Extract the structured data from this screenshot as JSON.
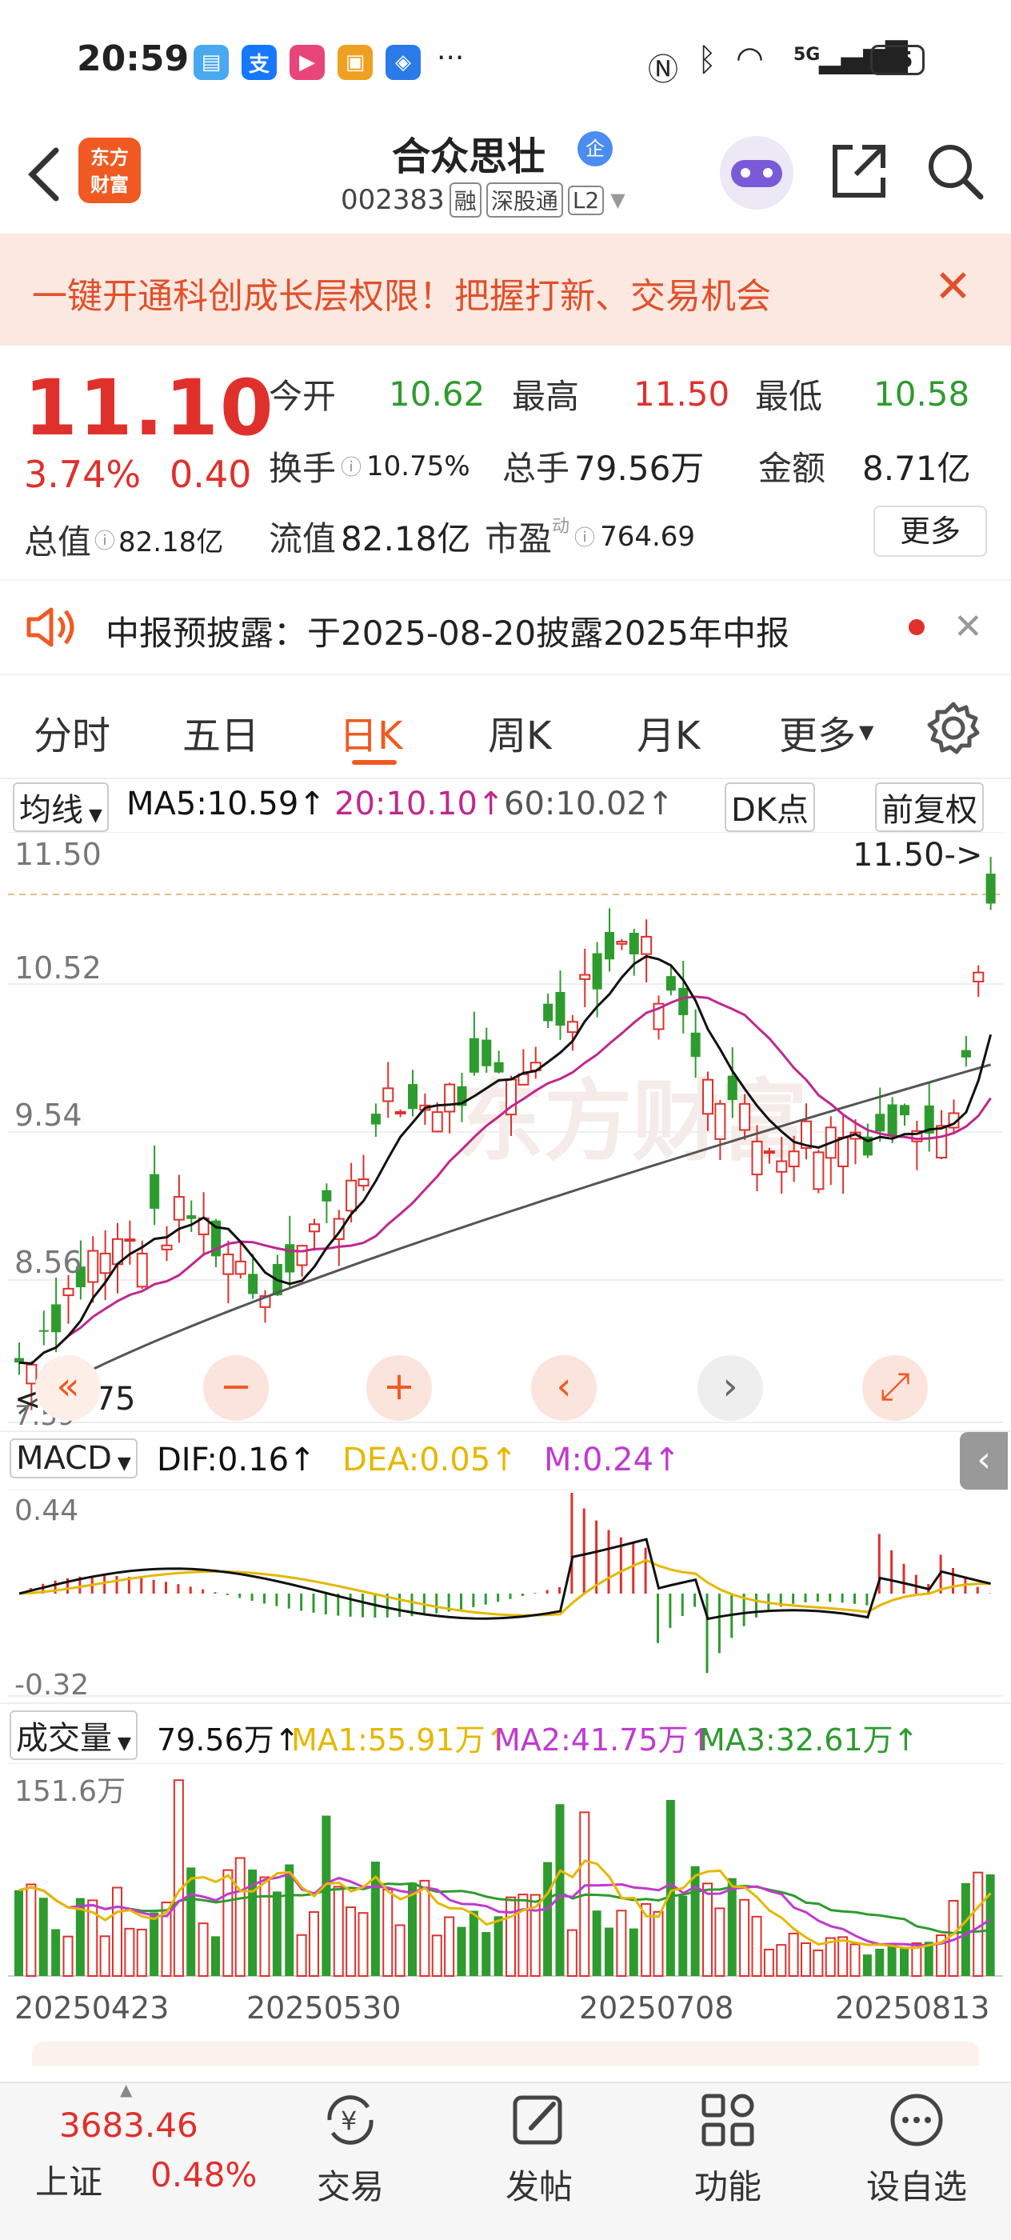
{
  "status_bar": {
    "time": "20:59",
    "battery": "55",
    "signal": "5G",
    "more": "···"
  },
  "header": {
    "stock_name": "合众思壮",
    "badge": "企",
    "stock_code": "002383",
    "tags": [
      "融",
      "深股通",
      "L2"
    ],
    "logo_line1": "东方",
    "logo_line2": "财富"
  },
  "banner": {
    "text": "一键开通科创成长层权限！把握打新、交易机会"
  },
  "quote": {
    "price": "11.10",
    "change_pct": "3.74%",
    "change_abs": "0.40",
    "open_label": "今开",
    "open": "10.62",
    "high_label": "最高",
    "high": "11.50",
    "low_label": "最低",
    "low": "10.58",
    "turnover_label": "换手",
    "turnover": "10.75%",
    "volume_label": "总手",
    "volume": "79.56万",
    "amount_label": "金额",
    "amount": "8.71亿",
    "mktcap_label": "总值",
    "mktcap": "82.18亿",
    "float_label": "流值",
    "float_cap": "82.18亿",
    "pe_label": "市盈",
    "pe_sup": "动",
    "pe": "764.69",
    "more_button": "更多"
  },
  "notice": {
    "text": "中报预披露：于2025-08-20披露2025年中报"
  },
  "tabs": [
    "分时",
    "五日",
    "日K",
    "周K",
    "月K",
    "更多"
  ],
  "ma_row": {
    "selector": "均线",
    "ma5": "MA5:10.59↑",
    "ma20": "20:10.10↑",
    "ma60": "60:10.02↑",
    "dk_button": "DK点",
    "adjust_button": "前复权"
  },
  "kline": {
    "y_labels": [
      "11.50",
      "10.52",
      "9.54",
      "8.56"
    ],
    "high_marker": "11.50->",
    "low_marker": "<--7.75",
    "bottom_label": "7.59"
  },
  "macd_row": {
    "selector": "MACD",
    "dif": "DIF:0.16↑",
    "dea": "DEA:0.05↑",
    "m": "M:0.24↑",
    "y_top": "0.44",
    "y_bottom": "-0.32"
  },
  "volume_row": {
    "selector": "成交量",
    "vol": "79.56万↑",
    "ma1": "MA1:55.91万↑",
    "ma2": "MA2:41.75万↑",
    "ma3": "MA3:32.61万↑",
    "y_top": "151.6万"
  },
  "x_dates": [
    "20250423",
    "20250530",
    "20250708",
    "20250813"
  ],
  "bottom_bar": {
    "index_value": "3683.46",
    "index_name": "上证",
    "index_change": "0.48%",
    "items": [
      "交易",
      "发帖",
      "功能",
      "设自选"
    ]
  },
  "colors": {
    "up": "#e0302c",
    "down": "#2e9b2e",
    "accent": "#f05a22",
    "ma5": "#111111",
    "ma20": "#c0288c",
    "ma60": "#555555",
    "dea": "#e5b800",
    "m": "#c03ad0"
  }
}
